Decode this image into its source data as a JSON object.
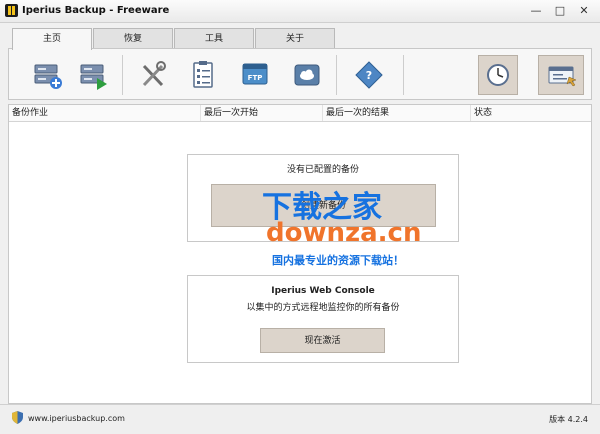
{
  "window": {
    "title": "Iperius Backup - Freeware",
    "min": "—",
    "max": "□",
    "close": "✕"
  },
  "tabs": [
    {
      "label": "主页",
      "active": true
    },
    {
      "label": "恢复"
    },
    {
      "label": "工具"
    },
    {
      "label": "关于"
    }
  ],
  "toolbar": {
    "icons": [
      "new-backup-icon",
      "run-backup-icon",
      "tools-icon",
      "checklist-icon",
      "ftp-icon",
      "cloud-icon",
      "help-book-icon",
      "scheduler-clock-icon",
      "console-icon"
    ]
  },
  "table": {
    "headers": [
      "备份作业",
      "最后一次开始",
      "最后一次的结果",
      "状态"
    ]
  },
  "no_backup": {
    "message": "没有已配置的备份",
    "button": "创建新备份"
  },
  "console": {
    "title": "Iperius Web Console",
    "desc": "以集中的方式远程地监控你的所有备份",
    "button": "现在激活"
  },
  "watermark": {
    "line1": "下载之家",
    "line2": "downza.cn",
    "line3": "国内最专业的资源下载站！"
  },
  "status": {
    "site": "www.iperiusbackup.com",
    "version": "版本 4.2.4"
  },
  "colors": {
    "accent_button": "#dcd4cb",
    "watermark_blue": "#1672e0",
    "watermark_orange": "#f0742b"
  }
}
